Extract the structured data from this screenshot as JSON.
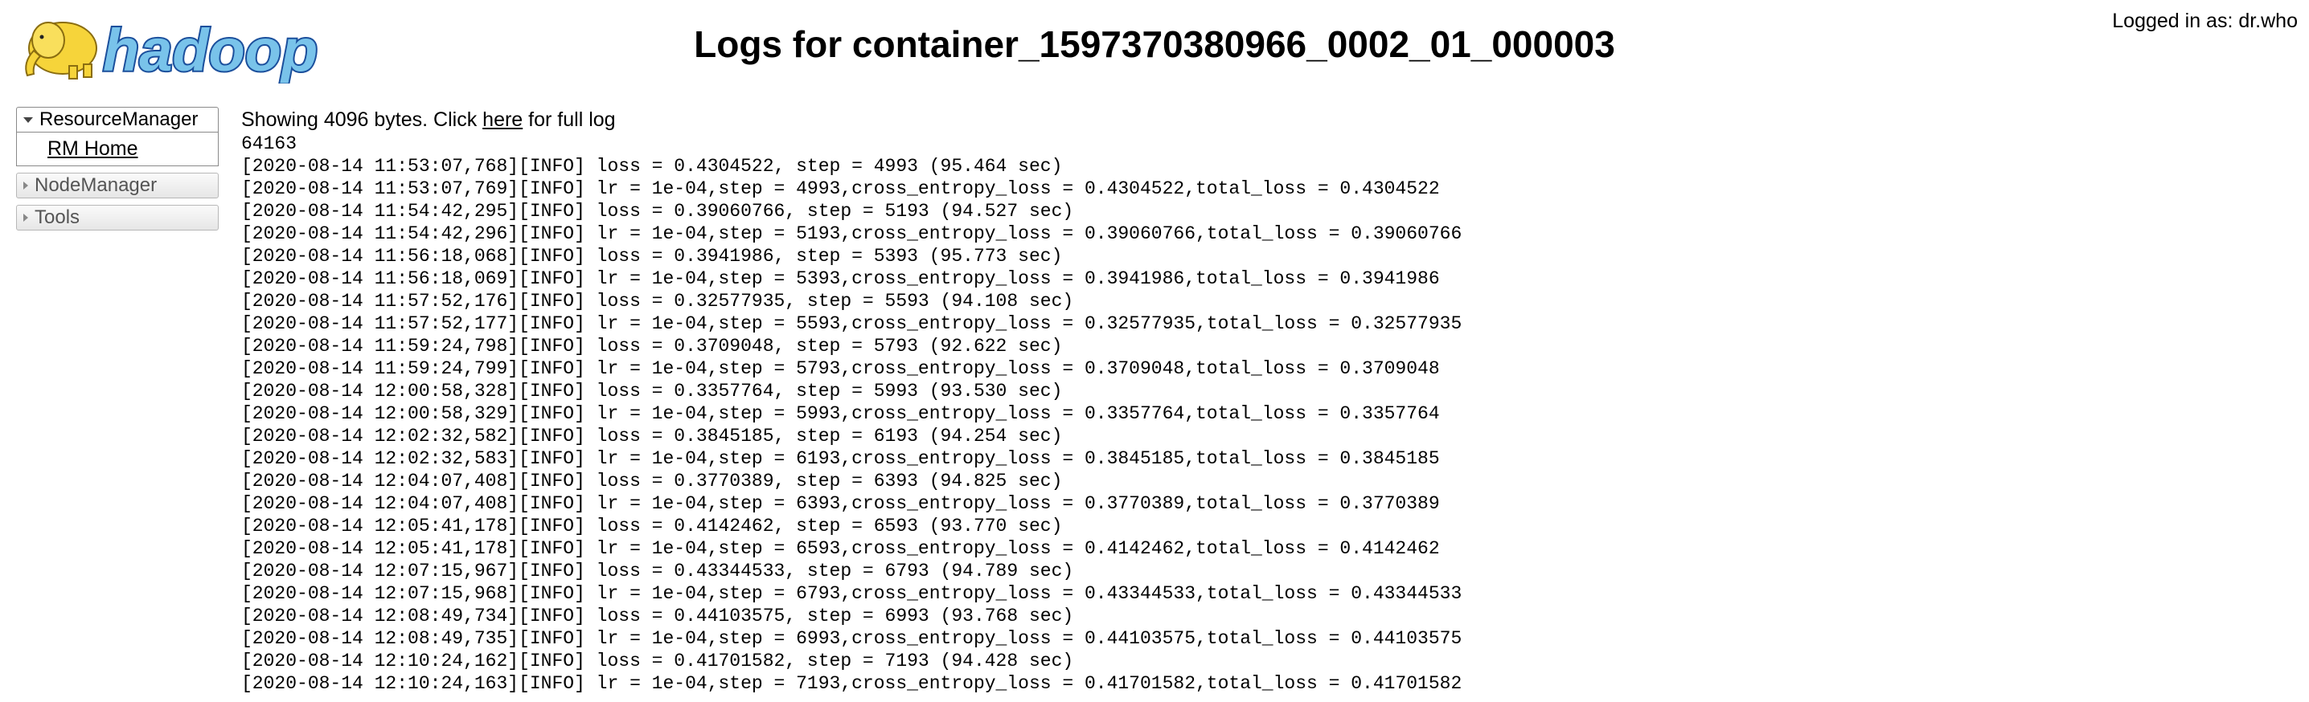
{
  "header": {
    "logo_text": "hadoop",
    "title": "Logs for container_1597370380966_0002_01_000003",
    "login_info": "Logged in as: dr.who"
  },
  "sidebar": {
    "groups": [
      {
        "label": "ResourceManager",
        "expanded": true,
        "items": [
          {
            "label": "RM Home"
          }
        ]
      },
      {
        "label": "NodeManager",
        "expanded": false
      },
      {
        "label": "Tools",
        "expanded": false
      }
    ]
  },
  "main": {
    "showing_prefix": "Showing 4096 bytes. Click ",
    "here_link": "here",
    "showing_suffix": " for full log",
    "log_lines": [
      "64163",
      "[2020-08-14 11:53:07,768][INFO] loss = 0.4304522, step = 4993 (95.464 sec)",
      "[2020-08-14 11:53:07,769][INFO] lr = 1e-04,step = 4993,cross_entropy_loss = 0.4304522,total_loss = 0.4304522",
      "[2020-08-14 11:54:42,295][INFO] loss = 0.39060766, step = 5193 (94.527 sec)",
      "[2020-08-14 11:54:42,296][INFO] lr = 1e-04,step = 5193,cross_entropy_loss = 0.39060766,total_loss = 0.39060766",
      "[2020-08-14 11:56:18,068][INFO] loss = 0.3941986, step = 5393 (95.773 sec)",
      "[2020-08-14 11:56:18,069][INFO] lr = 1e-04,step = 5393,cross_entropy_loss = 0.3941986,total_loss = 0.3941986",
      "[2020-08-14 11:57:52,176][INFO] loss = 0.32577935, step = 5593 (94.108 sec)",
      "[2020-08-14 11:57:52,177][INFO] lr = 1e-04,step = 5593,cross_entropy_loss = 0.32577935,total_loss = 0.32577935",
      "[2020-08-14 11:59:24,798][INFO] loss = 0.3709048, step = 5793 (92.622 sec)",
      "[2020-08-14 11:59:24,799][INFO] lr = 1e-04,step = 5793,cross_entropy_loss = 0.3709048,total_loss = 0.3709048",
      "[2020-08-14 12:00:58,328][INFO] loss = 0.3357764, step = 5993 (93.530 sec)",
      "[2020-08-14 12:00:58,329][INFO] lr = 1e-04,step = 5993,cross_entropy_loss = 0.3357764,total_loss = 0.3357764",
      "[2020-08-14 12:02:32,582][INFO] loss = 0.3845185, step = 6193 (94.254 sec)",
      "[2020-08-14 12:02:32,583][INFO] lr = 1e-04,step = 6193,cross_entropy_loss = 0.3845185,total_loss = 0.3845185",
      "[2020-08-14 12:04:07,408][INFO] loss = 0.3770389, step = 6393 (94.825 sec)",
      "[2020-08-14 12:04:07,408][INFO] lr = 1e-04,step = 6393,cross_entropy_loss = 0.3770389,total_loss = 0.3770389",
      "[2020-08-14 12:05:41,178][INFO] loss = 0.4142462, step = 6593 (93.770 sec)",
      "[2020-08-14 12:05:41,178][INFO] lr = 1e-04,step = 6593,cross_entropy_loss = 0.4142462,total_loss = 0.4142462",
      "[2020-08-14 12:07:15,967][INFO] loss = 0.43344533, step = 6793 (94.789 sec)",
      "[2020-08-14 12:07:15,968][INFO] lr = 1e-04,step = 6793,cross_entropy_loss = 0.43344533,total_loss = 0.43344533",
      "[2020-08-14 12:08:49,734][INFO] loss = 0.44103575, step = 6993 (93.768 sec)",
      "[2020-08-14 12:08:49,735][INFO] lr = 1e-04,step = 6993,cross_entropy_loss = 0.44103575,total_loss = 0.44103575",
      "[2020-08-14 12:10:24,162][INFO] loss = 0.41701582, step = 7193 (94.428 sec)",
      "[2020-08-14 12:10:24,163][INFO] lr = 1e-04,step = 7193,cross_entropy_loss = 0.41701582,total_loss = 0.41701582"
    ]
  },
  "colors": {
    "logo_blue": "#1b4f9c",
    "logo_yellow": "#f6d43a",
    "logo_text_fill": "#79c3ea"
  }
}
